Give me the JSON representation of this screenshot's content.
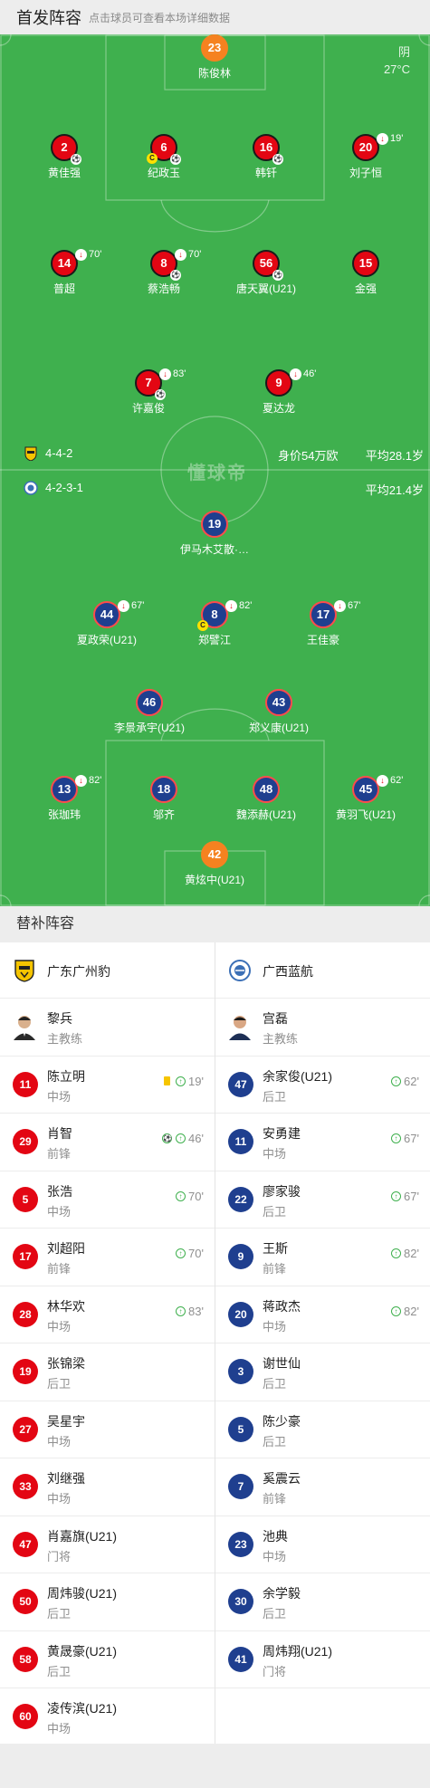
{
  "header": {
    "title": "首发阵容",
    "subtitle": "点击球员可查看本场详细数据"
  },
  "weather": {
    "condition": "阴",
    "temperature": "27°C"
  },
  "team_home": {
    "formation": "4-4-2",
    "market_value": "身价54万欧",
    "avg_age": "平均28.1岁",
    "players": [
      {
        "num": "23",
        "name": "陈俊林",
        "role": "gk",
        "sub_min": ""
      },
      {
        "num": "2",
        "name": "黄佳强",
        "sub_min": "",
        "badge": "og"
      },
      {
        "num": "6",
        "name": "纪政玉",
        "sub_min": "",
        "badge": "cap",
        "badge2": "og"
      },
      {
        "num": "16",
        "name": "韩钎",
        "sub_min": "",
        "badge": "ball"
      },
      {
        "num": "20",
        "name": "刘子恒",
        "sub_min": "19'"
      },
      {
        "num": "14",
        "name": "普超",
        "sub_min": "70'"
      },
      {
        "num": "8",
        "name": "蔡浩畅",
        "sub_min": "70'",
        "badge": "og"
      },
      {
        "num": "56",
        "name": "唐天翼(U21)",
        "sub_min": "",
        "badge": "ball"
      },
      {
        "num": "15",
        "name": "金强",
        "sub_min": ""
      },
      {
        "num": "7",
        "name": "许嘉俊",
        "sub_min": "83'",
        "badge": "ball"
      },
      {
        "num": "9",
        "name": "夏达龙",
        "sub_min": "46'"
      }
    ]
  },
  "team_away": {
    "formation": "4-2-3-1",
    "avg_age": "平均21.4岁",
    "players": [
      {
        "num": "19",
        "name": "伊马木艾散·…",
        "sub_min": ""
      },
      {
        "num": "44",
        "name": "夏政荣(U21)",
        "sub_min": "67'"
      },
      {
        "num": "8",
        "name": "郑譬江",
        "sub_min": "82'",
        "badge": "cap"
      },
      {
        "num": "17",
        "name": "王佳豪",
        "sub_min": "67'"
      },
      {
        "num": "46",
        "name": "李景承宇(U21)",
        "sub_min": ""
      },
      {
        "num": "43",
        "name": "郑义康(U21)",
        "sub_min": ""
      },
      {
        "num": "13",
        "name": "张珈玮",
        "sub_min": "82'"
      },
      {
        "num": "18",
        "name": "邬齐",
        "sub_min": ""
      },
      {
        "num": "48",
        "name": "魏添赫(U21)",
        "sub_min": ""
      },
      {
        "num": "45",
        "name": "黄羽飞(U21)",
        "sub_min": "62'"
      },
      {
        "num": "42",
        "name": "黄炫中(U21)",
        "role": "gk",
        "sub_min": ""
      }
    ]
  },
  "watermark": "懂球帝",
  "subs_section": {
    "title": "替补阵容",
    "home": {
      "team_name": "广东广州豹",
      "coach": {
        "name": "黎兵",
        "role": "主教练"
      },
      "players": [
        {
          "num": "11",
          "name": "陈立明",
          "pos": "中场",
          "yellow": true,
          "goal": false,
          "in": "19'"
        },
        {
          "num": "29",
          "name": "肖智",
          "pos": "前锋",
          "yellow": false,
          "goal": true,
          "in": "46'"
        },
        {
          "num": "5",
          "name": "张浩",
          "pos": "中场",
          "in": "70'"
        },
        {
          "num": "17",
          "name": "刘超阳",
          "pos": "前锋",
          "in": "70'"
        },
        {
          "num": "28",
          "name": "林华欢",
          "pos": "中场",
          "in": "83'"
        },
        {
          "num": "19",
          "name": "张锦梁",
          "pos": "后卫",
          "in": ""
        },
        {
          "num": "27",
          "name": "吴星宇",
          "pos": "中场",
          "in": ""
        },
        {
          "num": "33",
          "name": "刘继强",
          "pos": "中场",
          "in": ""
        },
        {
          "num": "47",
          "name": "肖嘉旗(U21)",
          "pos": "门将",
          "in": ""
        },
        {
          "num": "50",
          "name": "周炜骏(U21)",
          "pos": "后卫",
          "in": ""
        },
        {
          "num": "58",
          "name": "黄晟豪(U21)",
          "pos": "后卫",
          "in": ""
        },
        {
          "num": "60",
          "name": "凌传滨(U21)",
          "pos": "中场",
          "in": ""
        }
      ]
    },
    "away": {
      "team_name": "广西蓝航",
      "coach": {
        "name": "宫磊",
        "role": "主教练"
      },
      "players": [
        {
          "num": "47",
          "name": "余家俊(U21)",
          "pos": "后卫",
          "in": "62'"
        },
        {
          "num": "11",
          "name": "安勇建",
          "pos": "中场",
          "in": "67'"
        },
        {
          "num": "22",
          "name": "廖家骏",
          "pos": "后卫",
          "in": "67'"
        },
        {
          "num": "9",
          "name": "王斯",
          "pos": "前锋",
          "in": "82'"
        },
        {
          "num": "20",
          "name": "蒋政杰",
          "pos": "中场",
          "in": "82'"
        },
        {
          "num": "3",
          "name": "谢世仙",
          "pos": "后卫",
          "in": ""
        },
        {
          "num": "5",
          "name": "陈少豪",
          "pos": "后卫",
          "in": ""
        },
        {
          "num": "7",
          "name": "奚震云",
          "pos": "前锋",
          "in": ""
        },
        {
          "num": "23",
          "name": "池典",
          "pos": "中场",
          "in": ""
        },
        {
          "num": "30",
          "name": "余学毅",
          "pos": "后卫",
          "in": ""
        },
        {
          "num": "41",
          "name": "周炜翔(U21)",
          "pos": "门将",
          "in": ""
        }
      ]
    }
  },
  "colors": {
    "pitch": "#3fb04e",
    "home": "#e30613",
    "away": "#1f3f8f",
    "gk": "#f58220"
  }
}
